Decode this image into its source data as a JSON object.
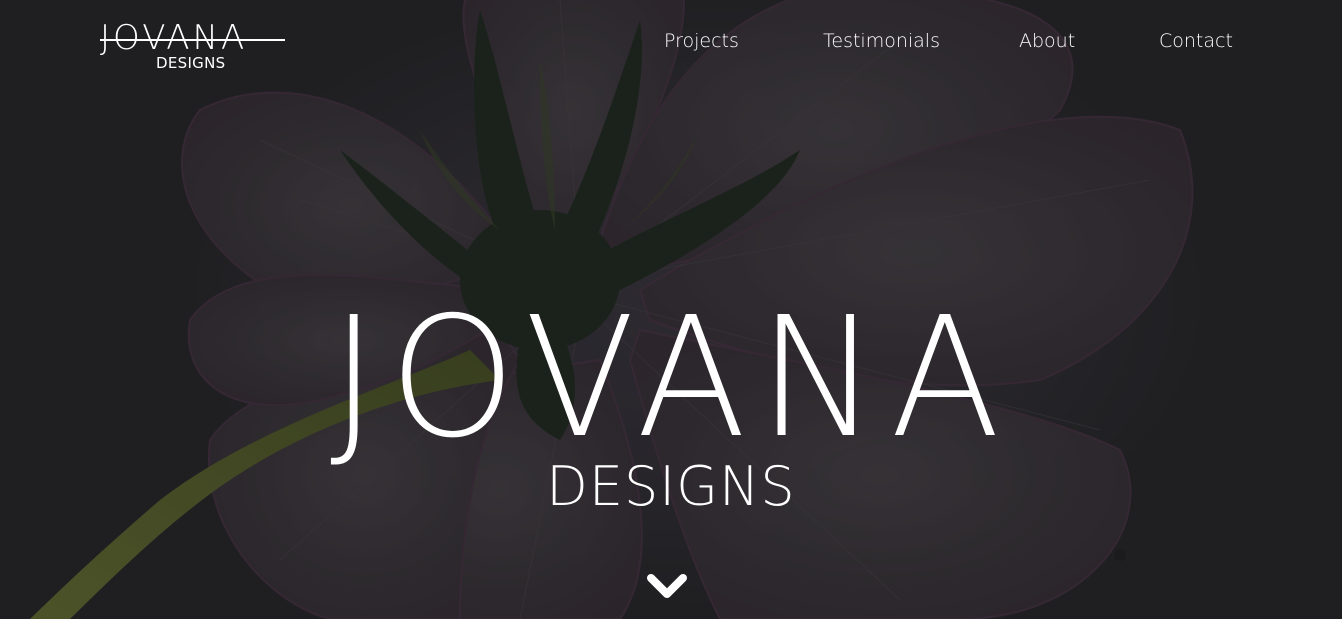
{
  "brand": {
    "logo_main": "JOVANA",
    "logo_sub": "DESIGNS"
  },
  "nav": {
    "items": [
      {
        "label": "Projects"
      },
      {
        "label": "Testimonials"
      },
      {
        "label": "About"
      },
      {
        "label": "Contact"
      }
    ]
  },
  "hero": {
    "title": "JOVANA",
    "subtitle": "DESIGNS",
    "scroll_icon": "chevron-down-icon"
  },
  "colors": {
    "background": "#2a292d",
    "text": "#ffffff",
    "petal": "#3a3539",
    "stem": "#5f6a2c",
    "sepal": "#1e2a1d"
  }
}
